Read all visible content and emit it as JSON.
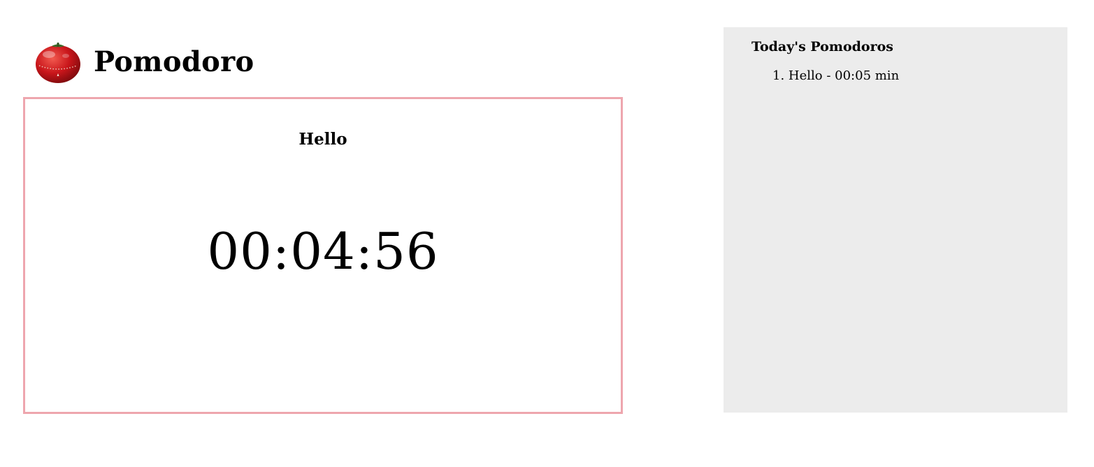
{
  "header": {
    "logo_icon": "tomato-timer-icon",
    "title": "Pomodoro"
  },
  "timer": {
    "task_name": "Hello",
    "countdown": "00:04:56",
    "border_color": "#eea6ae"
  },
  "history": {
    "title": "Today's Pomodoros",
    "items": [
      {
        "index": "1.",
        "text": "Hello - 00:05 min"
      }
    ],
    "background_color": "#ececec"
  }
}
